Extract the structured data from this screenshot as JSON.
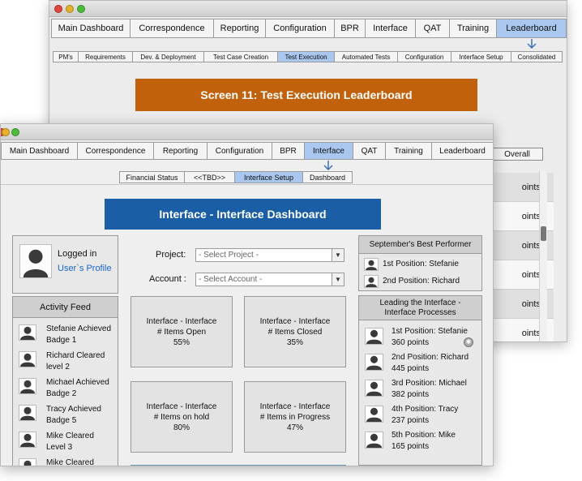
{
  "back_window": {
    "nav": [
      "Main Dashboard",
      "Correspondence",
      "Reporting",
      "Configuration",
      "BPR",
      "Interface",
      "QAT",
      "Training",
      "Leaderboard"
    ],
    "nav_active": "Leaderboard",
    "subnav": [
      "PM's",
      "Requirements",
      "Dev. & Deployment",
      "Test Case Creation",
      "Test Execution",
      "Automated Tests",
      "Configuration",
      "Interface Setup",
      "Consolidated"
    ],
    "subnav_active": "Test Execution",
    "banner": "Screen 11: Test Execution Leaderboard",
    "overall_label": "Overall",
    "points_rows": [
      "oints",
      "oints",
      "oints",
      "oints",
      "oints",
      "oints"
    ]
  },
  "front_window": {
    "nav": [
      "Main Dashboard",
      "Correspondence",
      "Reporting",
      "Configuration",
      "BPR",
      "Interface",
      "QAT",
      "Training",
      "Leaderboard"
    ],
    "nav_active": "Interface",
    "subnav": [
      "Financial Status",
      "<<TBD>>",
      "Interface Setup",
      "Dashboard"
    ],
    "subnav_active": "Interface Setup",
    "banner": "Interface - Interface Dashboard",
    "login": {
      "label": "Logged in",
      "profile_link": "User`s Profile"
    },
    "activity_feed": {
      "title": "Activity Feed",
      "items": [
        {
          "line1": "Stefanie Achieved",
          "line2": "Badge 1"
        },
        {
          "line1": "Richard Cleared",
          "line2": "level 2"
        },
        {
          "line1": "Michael Achieved",
          "line2": "Badge 2"
        },
        {
          "line1": "Tracy Achieved",
          "line2": "Badge 5"
        },
        {
          "line1": "Mike Cleared",
          "line2": "Level 3"
        },
        {
          "line1": "Mike Cleared",
          "line2": ""
        }
      ]
    },
    "filters": {
      "project_label": "Project:",
      "project_value": "- Select Project -",
      "account_label": "Account :",
      "account_value": "- Select Account -"
    },
    "stats": [
      {
        "line1": "Interface - Interface",
        "line2": "# Items Open",
        "value": "55%"
      },
      {
        "line1": "Interface - Interface",
        "line2": "# Items Closed",
        "value": "35%"
      },
      {
        "line1": "Interface - Interface",
        "line2": "# Items on hold",
        "value": "80%"
      },
      {
        "line1": "Interface - Interface",
        "line2": "# Items in Progress",
        "value": "47%"
      }
    ],
    "best_performer": {
      "title": "September's Best Performer",
      "items": [
        {
          "text": "1st Position:   Stefanie"
        },
        {
          "text": "2nd Position: Richard"
        }
      ]
    },
    "leaders": {
      "title_line1": "Leading the Interface -",
      "title_line2": "Interface Processes",
      "items": [
        {
          "position": "1st Position: Stefanie",
          "points": "360  points"
        },
        {
          "position": "2nd Position: Richard",
          "points": "445 points"
        },
        {
          "position": "3rd Position: Michael",
          "points": "382 points"
        },
        {
          "position": "4th Position: Tracy",
          "points": "237 points"
        },
        {
          "position": "5th Position: Mike",
          "points": "165 points"
        }
      ]
    }
  }
}
